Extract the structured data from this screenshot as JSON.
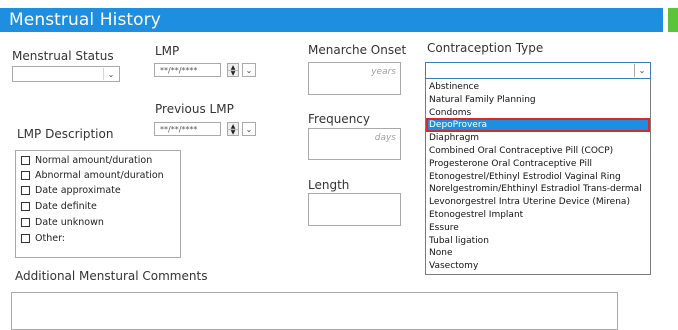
{
  "header": {
    "title": "Menstrual History"
  },
  "menstrual_status": {
    "label": "Menstrual Status",
    "value": ""
  },
  "lmp": {
    "label": "LMP",
    "value": "**/**/****"
  },
  "previous_lmp": {
    "label": "Previous LMP",
    "value": "**/**/****"
  },
  "lmp_description": {
    "label": "LMP Description",
    "options": [
      "Normal amount/duration",
      "Abnormal amount/duration",
      "Date approximate",
      "Date definite",
      "Date unknown",
      "Other:"
    ]
  },
  "menarche_onset": {
    "label": "Menarche Onset",
    "unit": "years",
    "value": ""
  },
  "frequency": {
    "label": "Frequency",
    "unit": "days",
    "value": ""
  },
  "length": {
    "label": "Length",
    "value": ""
  },
  "contraception": {
    "label": "Contraception Type",
    "value": "",
    "options": [
      "Abstinence",
      "Natural Family Planning",
      "Condoms",
      "DepoProvera",
      "Diaphragm",
      "Combined Oral Contraceptive Pill (COCP)",
      "Progesterone Oral Contraceptive Pill",
      "Etonogestrel/Ethinyl Estrodiol Vaginal Ring",
      "Norelgestromin/Ehthinyl Estradiol Trans-dermal",
      "Levonorgestrel Intra Uterine Device (Mirena)",
      "Etonogestrel Implant",
      "Essure",
      "Tubal ligation",
      "None",
      "Vasectomy"
    ],
    "highlighted": "DepoProvera"
  },
  "comments": {
    "label": "Additional Menstural Comments",
    "value": ""
  },
  "colors": {
    "header": "#1e8fe0",
    "accent_green": "#5cc43a",
    "highlight_border": "#d42a2a"
  }
}
